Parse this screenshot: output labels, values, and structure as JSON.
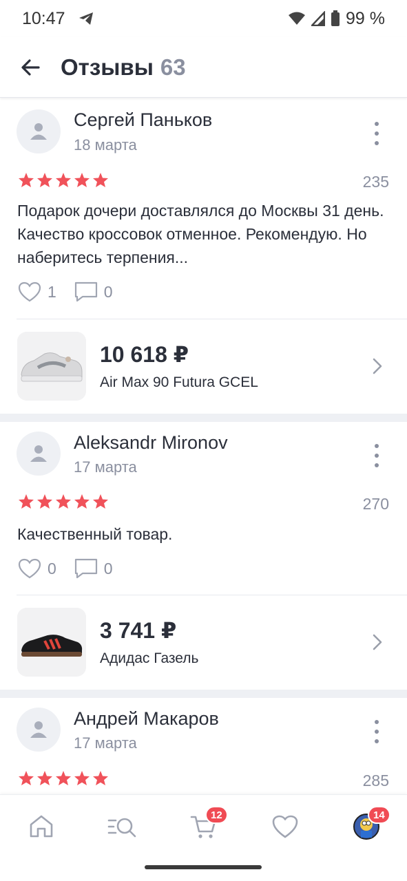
{
  "status_bar": {
    "time": "10:47",
    "battery": "99 %"
  },
  "header": {
    "title": "Отзывы",
    "count": "63"
  },
  "reviews": [
    {
      "author": "Сергей Паньков",
      "date": "18 марта",
      "stars": 5,
      "rating_number": "235",
      "text": "Подарок дочери доставлялся до Москвы 31 день. Качество кроссовок отменное. Рекомендую. Но наберитесь терпения...",
      "likes": "1",
      "comments": "0",
      "product": {
        "price": "10 618 ₽",
        "name": "Air Max 90 Futura GCEL"
      }
    },
    {
      "author": "Aleksandr Mironov",
      "date": "17 марта",
      "stars": 5,
      "rating_number": "270",
      "text": "Качественный товар.",
      "likes": "0",
      "comments": "0",
      "product": {
        "price": "3 741 ₽",
        "name": "Адидас Газель"
      }
    },
    {
      "author": "Андрей Макаров",
      "date": "17 марта",
      "stars": 5,
      "rating_number": "285"
    }
  ],
  "bottom_nav": {
    "items": [
      "home-icon",
      "catalog-search-icon",
      "cart-icon",
      "favorites-icon",
      "profile-avatar"
    ],
    "cart_badge": "12",
    "profile_badge": "14"
  },
  "colors": {
    "star": "#f0525a",
    "badge": "#f04b54",
    "muted": "#8a8f9f",
    "text": "#2b2f3a"
  }
}
